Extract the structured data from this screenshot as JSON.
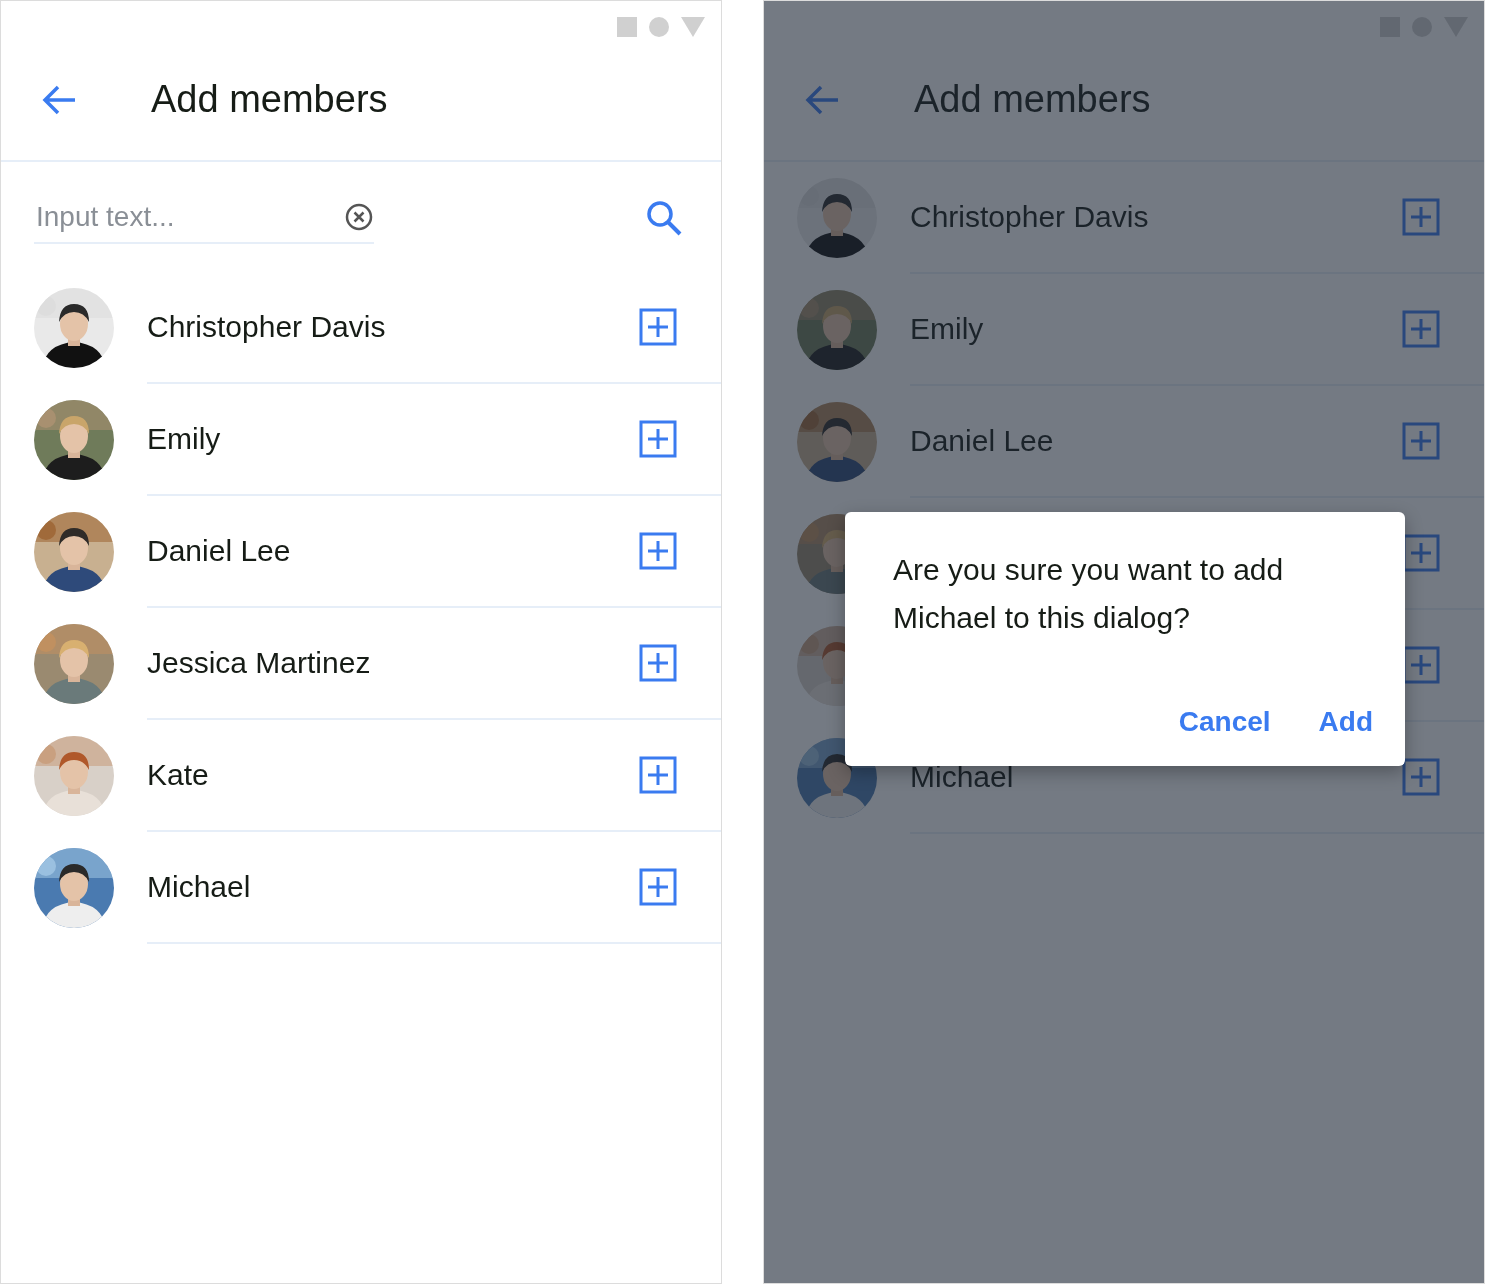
{
  "screens": [
    {
      "title": "Add members",
      "search": {
        "placeholder": "Input text..."
      },
      "members": [
        {
          "kind": "member",
          "name": "Christopher Davis"
        },
        {
          "kind": "member",
          "name": "Emily"
        },
        {
          "kind": "member",
          "name": "Daniel Lee"
        },
        {
          "kind": "member",
          "name": "Jessica Martinez"
        },
        {
          "kind": "member",
          "name": "Kate"
        },
        {
          "kind": "member",
          "name": "Michael"
        }
      ]
    },
    {
      "title": "Add members",
      "members": [
        {
          "kind": "member",
          "name": "Christopher Davis"
        },
        {
          "kind": "member",
          "name": "Emily"
        },
        {
          "kind": "member",
          "name": "Daniel Lee"
        },
        {
          "kind": "covered"
        },
        {
          "kind": "covered"
        },
        {
          "kind": "member",
          "name": "Michael"
        }
      ],
      "dialog": {
        "message": "Are you sure you want to add Michael to this dialog?",
        "buttons": [
          {
            "label": "Cancel"
          },
          {
            "label": "Add"
          }
        ]
      }
    }
  ]
}
